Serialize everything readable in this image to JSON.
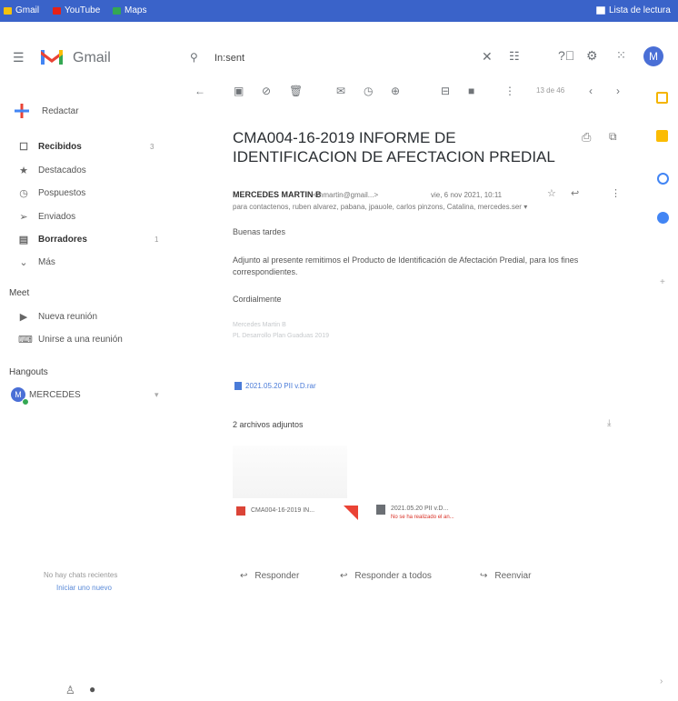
{
  "bookmarks": {
    "items": [
      {
        "label": "Gmail",
        "icon": "gmail-icon",
        "color": "#f4c20d"
      },
      {
        "label": "YouTube",
        "icon": "youtube-icon",
        "color": "#e62117"
      },
      {
        "label": "Maps",
        "icon": "maps-icon",
        "color": "#34a853"
      }
    ],
    "reading_list": "Lista de lectura"
  },
  "header": {
    "app_name": "Gmail",
    "search_value": "In:sent",
    "avatar_letter": "M"
  },
  "sidebar": {
    "compose_label": "Redactar",
    "items": [
      {
        "label": "Recibidos",
        "icon": "inbox-icon",
        "glyph": "☐",
        "bold": true,
        "count": "3"
      },
      {
        "label": "Destacados",
        "icon": "star-icon",
        "glyph": "★",
        "bold": false,
        "count": ""
      },
      {
        "label": "Pospuestos",
        "icon": "clock-icon",
        "glyph": "◷",
        "bold": false,
        "count": ""
      },
      {
        "label": "Enviados",
        "icon": "send-icon",
        "glyph": "➢",
        "bold": false,
        "count": ""
      },
      {
        "label": "Borradores",
        "icon": "draft-icon",
        "glyph": "▤",
        "bold": true,
        "count": "1"
      },
      {
        "label": "Más",
        "icon": "chevron-down-icon",
        "glyph": "⌄",
        "bold": false,
        "count": ""
      }
    ],
    "meet_title": "Meet",
    "meet_items": [
      {
        "label": "Nueva reunión",
        "icon": "video-icon",
        "glyph": "▶"
      },
      {
        "label": "Unirse a una reunión",
        "icon": "keyboard-icon",
        "glyph": "⌨"
      }
    ],
    "hangouts_title": "Hangouts",
    "hangouts_user": "MERCEDES",
    "hangouts_avatar_letter": "M",
    "footer_line1": "No hay chats recientes",
    "footer_line2": "Iniciar uno nuevo"
  },
  "toolbar": {
    "paging": "13 de 46"
  },
  "email": {
    "subject": "CMA004-16-2019 INFORME DE IDENTIFICACION DE AFECTACION PREDIAL",
    "sender": "MERCEDES MARTIN B",
    "sender_email": "<mmartin@gmail...>",
    "date": "vie, 6 nov 2021, 10:11",
    "recipients": "para contactenos, ruben alvarez, pabana, jpauole, carlos pinzons, Catalina, mercedes.ser ▾",
    "greeting": "Buenas tardes",
    "paragraph": "Adjunto al presente remitimos el Producto de Identificación de Afectación Predial, para los fines correspondientes.",
    "closing": "Cordialmente",
    "sig_line1": "Mercedes Martin B",
    "sig_line2": "PL Desarrollo Plan Guaduas 2019",
    "drive_link": "2021.05.20 PII v.D.rar",
    "attachments_title": "2 archivos adjuntos",
    "attachment1_name": "CMA004-16-2019 IN...",
    "attachment2_name": "2021.05.20 PII v.D...",
    "attachment2_note": "No se ha realizado el an..."
  },
  "actions": {
    "reply": "Responder",
    "reply_all": "Responder a todos",
    "forward": "Reenviar"
  },
  "colors": {
    "bookmark_bar": "#3a63c9",
    "gmail_red": "#ea4335",
    "pdf_red": "#db4437",
    "avatar_blue": "#4a6fd6"
  }
}
